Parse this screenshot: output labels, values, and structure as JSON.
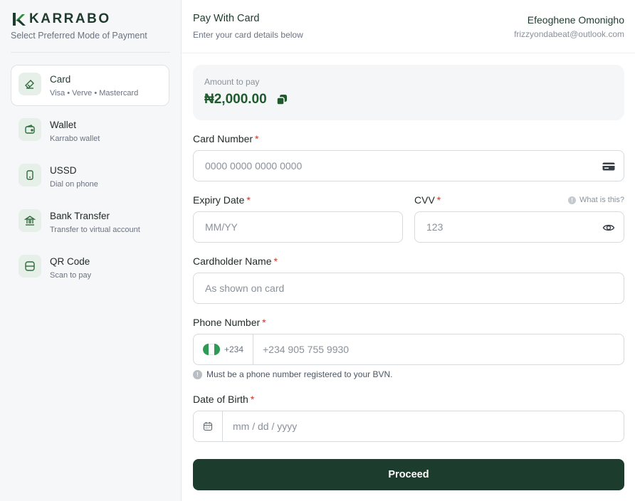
{
  "brand": {
    "name": "KARRABO",
    "subtitle": "Select Preferred Mode of Payment"
  },
  "sidebar": {
    "methods": [
      {
        "title": "Card",
        "subtitle": "Visa • Verve • Mastercard",
        "icon": "card-icon",
        "active": true
      },
      {
        "title": "Wallet",
        "subtitle": "Karrabo wallet",
        "icon": "wallet-icon",
        "active": false
      },
      {
        "title": "USSD",
        "subtitle": "Dial on phone",
        "icon": "phone-icon",
        "active": false
      },
      {
        "title": "Bank Transfer",
        "subtitle": "Transfer to virtual account",
        "icon": "bank-icon",
        "active": false
      },
      {
        "title": "QR Code",
        "subtitle": "Scan to pay",
        "icon": "qr-icon",
        "active": false
      }
    ]
  },
  "header": {
    "title": "Pay With Card",
    "subtitle": "Enter your card details below",
    "user_name": "Efeoghene Omonigho",
    "user_email": "frizzyondabeat@outlook.com"
  },
  "amount": {
    "label": "Amount to pay",
    "value": "₦2,000.00"
  },
  "form": {
    "card_number": {
      "label": "Card Number",
      "placeholder": "0000 0000 0000 0000"
    },
    "expiry": {
      "label": "Expiry Date",
      "placeholder": "MM/YY"
    },
    "cvv": {
      "label": "CVV",
      "placeholder": "123",
      "hint": "What is this?"
    },
    "cardholder": {
      "label": "Cardholder Name",
      "placeholder": "As shown on card"
    },
    "phone": {
      "label": "Phone Number",
      "prefix": "+234",
      "placeholder": "+234 905 755 9930",
      "note": "Must be a phone number registered to your BVN."
    },
    "dob": {
      "label": "Date of Birth",
      "placeholder": "mm / dd / yyyy"
    },
    "required_mark": "*"
  },
  "proceed_label": "Proceed",
  "colors": {
    "brand_dark": "#1c3d2e",
    "brand_green": "#1e5a2e",
    "icon_bg": "#e6efe8",
    "required": "#c0392b"
  }
}
